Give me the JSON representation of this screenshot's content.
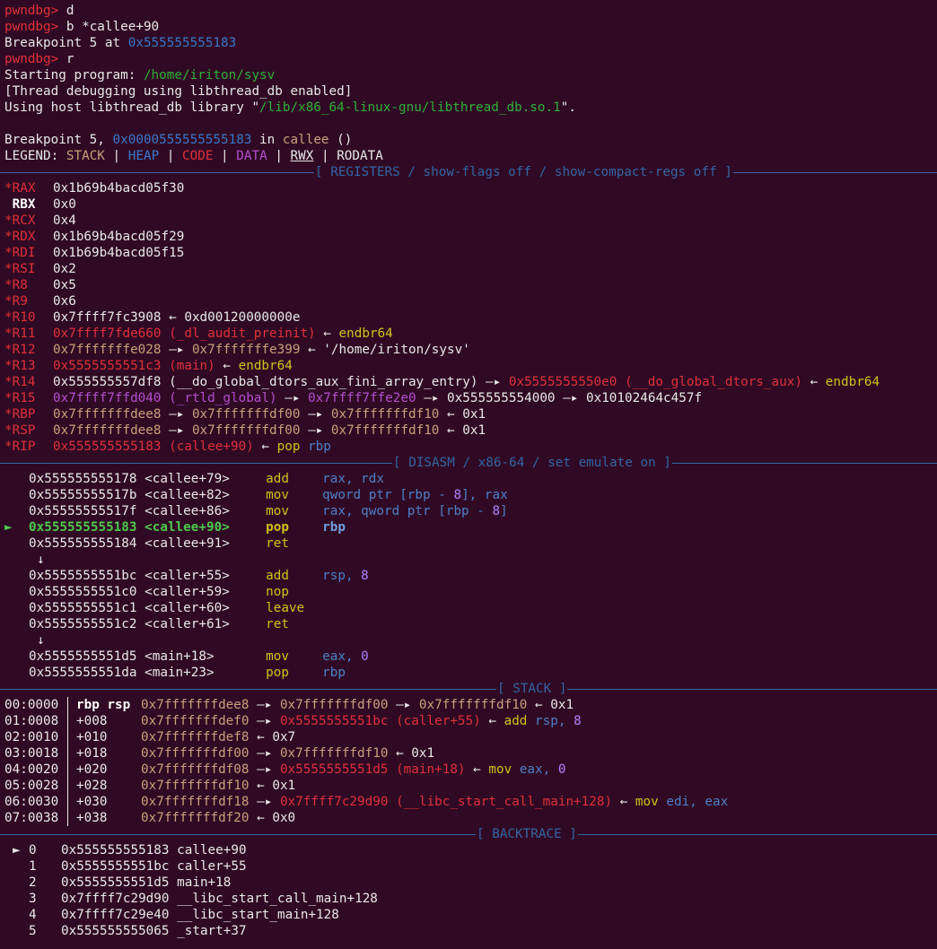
{
  "prompt": "pwndbg>",
  "cmd1": "d",
  "cmd2": "b *callee+90",
  "bp_set": "Breakpoint 5 at ",
  "bp_set_addr": "0x555555555183",
  "cmd3": "r",
  "starting": "Starting program: ",
  "prog_path": "/home/iriton/sysv",
  "thread_dbg": "[Thread debugging using libthread_db enabled]",
  "host_lib_prefix": "Using host libthread_db library \"",
  "host_lib_path": "/lib/x86_64-linux-gnu/libthread_db.so.1",
  "host_lib_suffix": "\".",
  "bp_hit_prefix": "Breakpoint 5, ",
  "bp_hit_addr": "0x0000555555555183",
  "bp_hit_in": " in ",
  "bp_hit_func": "callee",
  "bp_hit_suffix": " ()",
  "legend": {
    "label": "LEGEND: ",
    "stack": "STACK",
    "heap": "HEAP",
    "code": "CODE",
    "data": "DATA",
    "rwx": "RWX",
    "rodata": "RODATA",
    "sep": " | "
  },
  "sections": {
    "registers": "[ REGISTERS / show-flags off / show-compact-regs off ]",
    "disasm": "[ DISASM / x86-64 / set emulate on ]",
    "stack": "[ STACK ]",
    "backtrace": "[ BACKTRACE ]"
  },
  "registers": [
    {
      "star": "*",
      "name": "RAX",
      "val": "0x1b69b4bacd05f30"
    },
    {
      "star": " ",
      "name": "RBX",
      "val": "0x0"
    },
    {
      "star": "*",
      "name": "RCX",
      "val": "0x4"
    },
    {
      "star": "*",
      "name": "RDX",
      "val": "0x1b69b4bacd05f29"
    },
    {
      "star": "*",
      "name": "RDI",
      "val": "0x1b69b4bacd05f15"
    },
    {
      "star": "*",
      "name": "RSI",
      "val": "0x2"
    },
    {
      "star": "*",
      "name": "R8",
      "val": "0x5"
    },
    {
      "star": "*",
      "name": "R9",
      "val": "0x6"
    }
  ],
  "r10": {
    "name": "R10",
    "a": "0x7ffff7fc3908",
    "b": "0xd00120000000e"
  },
  "r11": {
    "name": "R11",
    "a": "0x7ffff7fde660",
    "sym": " (_dl_audit_preinit)",
    "ins": "endbr64"
  },
  "r12": {
    "name": "R12",
    "a": "0x7fffffffe028",
    "b": "0x7fffffffe399",
    "str": "'/home/iriton/sysv'"
  },
  "r13": {
    "name": "R13",
    "a": "0x5555555551c3",
    "sym": " (main)",
    "ins": "endbr64"
  },
  "r14": {
    "name": "R14",
    "a": "0x555555557df8",
    "sym": " (__do_global_dtors_aux_fini_array_entry)",
    "b": "0x5555555550e0",
    "bsym": " (__do_global_dtors_aux)",
    "ins": "endbr64"
  },
  "r15": {
    "name": "R15",
    "a": "0x7ffff7ffd040",
    "sym": " (_rtld_global)",
    "b": "0x7ffff7ffe2e0",
    "c": "0x555555554000",
    "d": "0x10102464c457f"
  },
  "rbp": {
    "name": "RBP",
    "a": "0x7fffffffdee8",
    "b": "0x7fffffffdf00",
    "c": "0x7fffffffdf10",
    "d": "0x1"
  },
  "rsp": {
    "name": "RSP",
    "a": "0x7fffffffdee8",
    "b": "0x7fffffffdf00",
    "c": "0x7fffffffdf10",
    "d": "0x1"
  },
  "rip": {
    "name": "RIP",
    "a": "0x555555555183",
    "sym": " (callee+90)",
    "ins": "pop",
    "op": "rbp"
  },
  "left_arrow": " ← ",
  "right_arrow": " —▸ ",
  "disasm": [
    {
      "addr": "0x555555555178",
      "sym": "<callee+79>",
      "mn": "add",
      "op": "rax, rdx"
    },
    {
      "addr": "0x55555555517b",
      "sym": "<callee+82>",
      "mn": "mov",
      "op": "qword ptr [rbp - ",
      "num": "8",
      "op2": "], rax"
    },
    {
      "addr": "0x55555555517f",
      "sym": "<callee+86>",
      "mn": "mov",
      "op": "rax, qword ptr [rbp - ",
      "num": "8",
      "op2": "]"
    },
    {
      "addr": "0x555555555183",
      "sym": "<callee+90>",
      "mn": "pop",
      "op": "rbp",
      "current": true
    },
    {
      "addr": "0x555555555184",
      "sym": "<callee+91>",
      "mn": "ret",
      "op": ""
    },
    {
      "addr": "0x5555555551bc",
      "sym": "<caller+55>",
      "mn": "add",
      "op": "rsp, ",
      "num": "8"
    },
    {
      "addr": "0x5555555551c0",
      "sym": "<caller+59>",
      "mn": "nop",
      "op": ""
    },
    {
      "addr": "0x5555555551c1",
      "sym": "<caller+60>",
      "mn": "leave",
      "op": ""
    },
    {
      "addr": "0x5555555551c2",
      "sym": "<caller+61>",
      "mn": "ret",
      "op": ""
    },
    {
      "addr": "0x5555555551d5",
      "sym": "<main+18>",
      "mn": "mov",
      "op": "eax, ",
      "num": "0"
    },
    {
      "addr": "0x5555555551da",
      "sym": "<main+23>",
      "mn": "pop",
      "op": "rbp"
    }
  ],
  "cur_marker": "►",
  "down_arrow": "↓",
  "stack": [
    {
      "idx": "00:0000",
      "regs": "rbp rsp",
      "ptr": "0x7fffffffdee8",
      "chain": [
        "0x7fffffffdf00",
        "0x7fffffffdf10"
      ],
      "val": "0x1"
    },
    {
      "idx": "01:0008",
      "off": "+008",
      "ptr": "0x7fffffffdef0",
      "code": "0x5555555551bc",
      "sym": " (caller+55)",
      "ins": "add",
      "op": "rsp, ",
      "num": "8"
    },
    {
      "idx": "02:0010",
      "off": "+010",
      "ptr": "0x7fffffffdef8",
      "val": "0x7"
    },
    {
      "idx": "03:0018",
      "off": "+018",
      "ptr": "0x7fffffffdf00",
      "chain": [
        "0x7fffffffdf10"
      ],
      "val": "0x1"
    },
    {
      "idx": "04:0020",
      "off": "+020",
      "ptr": "0x7fffffffdf08",
      "code": "0x5555555551d5",
      "sym": " (main+18)",
      "ins": "mov",
      "op": "eax, ",
      "num": "0"
    },
    {
      "idx": "05:0028",
      "off": "+028",
      "ptr": "0x7fffffffdf10",
      "val": "0x1"
    },
    {
      "idx": "06:0030",
      "off": "+030",
      "ptr": "0x7fffffffdf18",
      "code": "0x7ffff7c29d90",
      "sym": " (__libc_start_call_main+128)",
      "ins": "mov",
      "op": "edi, eax"
    },
    {
      "idx": "07:0038",
      "off": "+038",
      "ptr": "0x7fffffffdf20",
      "val": "0x0"
    }
  ],
  "backtrace": [
    {
      "n": "0",
      "addr": "0x555555555183",
      "sym": "callee+90",
      "current": true
    },
    {
      "n": "1",
      "addr": "0x5555555551bc",
      "sym": "caller+55"
    },
    {
      "n": "2",
      "addr": "0x5555555551d5",
      "sym": "main+18"
    },
    {
      "n": "3",
      "addr": "0x7ffff7c29d90",
      "sym": "__libc_start_call_main+128"
    },
    {
      "n": "4",
      "addr": "0x7ffff7c29e40",
      "sym": "__libc_start_main+128"
    },
    {
      "n": "5",
      "addr": "0x555555555065",
      "sym": "_start+37"
    }
  ],
  "colors": {
    "background": "#300a24",
    "prompt": "#e0303a",
    "section": "#3465a4",
    "current": "#4ec94e"
  }
}
